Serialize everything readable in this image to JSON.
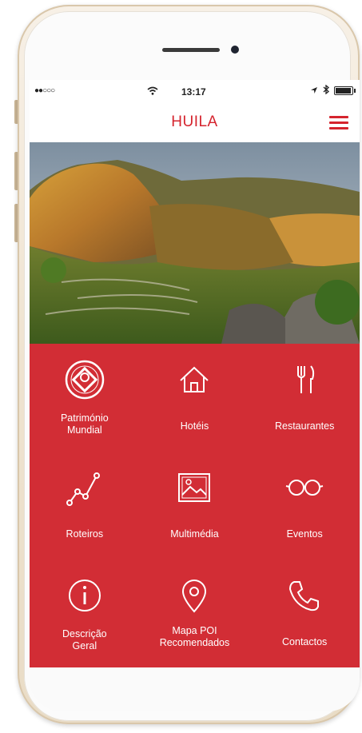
{
  "status_bar": {
    "carrier": "●●○○○",
    "time": "13:17"
  },
  "nav": {
    "title": "HUILA"
  },
  "menu": [
    {
      "label": "Património\nMundial",
      "icon": "world-heritage-icon"
    },
    {
      "label": "Hotéis",
      "icon": "house-icon"
    },
    {
      "label": "Restaurantes",
      "icon": "fork-knife-icon"
    },
    {
      "label": "Roteiros",
      "icon": "route-icon"
    },
    {
      "label": "Multimédia",
      "icon": "picture-icon"
    },
    {
      "label": "Eventos",
      "icon": "glasses-icon"
    },
    {
      "label": "Descrição\nGeral",
      "icon": "info-icon"
    },
    {
      "label": "Mapa POI\nRecomendados",
      "icon": "map-pin-icon"
    },
    {
      "label": "Contactos",
      "icon": "phone-icon"
    }
  ],
  "colors": {
    "accent": "#d5242e",
    "tile_bg": "#d22d35"
  }
}
